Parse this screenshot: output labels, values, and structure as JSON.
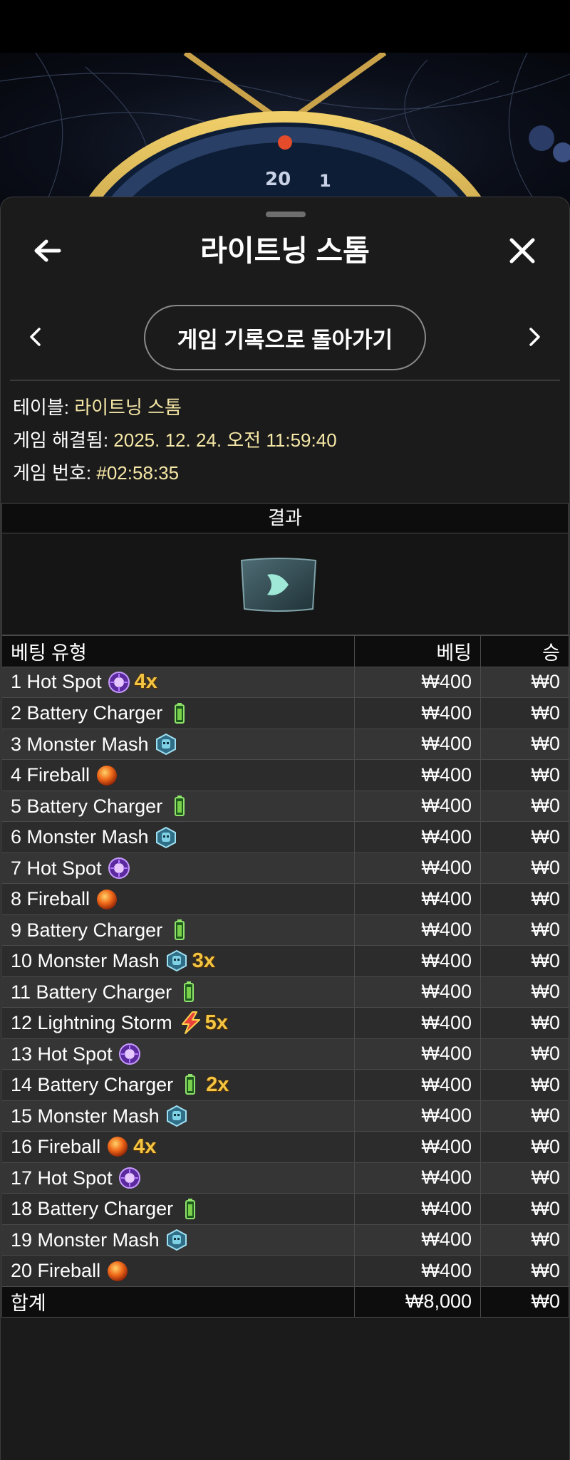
{
  "header": {
    "title": "라이트닝 스톰",
    "back_icon": "arrow-left-icon",
    "close_icon": "close-icon"
  },
  "navigation": {
    "prev_icon": "chevron-left-icon",
    "next_icon": "chevron-right-icon",
    "history_button": "게임 기록으로 돌아가기"
  },
  "info": {
    "table_label": "테이블:",
    "table_value": "라이트닝 스톰",
    "resolved_label": "게임 해결됨:",
    "resolved_value": "2025. 12. 24. 오전 11:59:40",
    "game_no_label": "게임 번호:",
    "game_no_value": "#02:58:35"
  },
  "result": {
    "heading": "결과",
    "icon": "result-card-icon"
  },
  "table": {
    "headers": [
      "베팅 유형",
      "베팅",
      "승"
    ],
    "rows": [
      {
        "label": "1 Hot Spot",
        "icon": "hot-spot",
        "mult": "4x",
        "bet": "₩400",
        "win": "₩0"
      },
      {
        "label": "2 Battery Charger",
        "icon": "battery",
        "mult": "",
        "bet": "₩400",
        "win": "₩0"
      },
      {
        "label": "3 Monster Mash",
        "icon": "monster",
        "mult": "",
        "bet": "₩400",
        "win": "₩0"
      },
      {
        "label": "4 Fireball",
        "icon": "fireball",
        "mult": "",
        "bet": "₩400",
        "win": "₩0"
      },
      {
        "label": "5 Battery Charger",
        "icon": "battery",
        "mult": "",
        "bet": "₩400",
        "win": "₩0"
      },
      {
        "label": "6 Monster Mash",
        "icon": "monster",
        "mult": "",
        "bet": "₩400",
        "win": "₩0"
      },
      {
        "label": "7 Hot Spot",
        "icon": "hot-spot",
        "mult": "",
        "bet": "₩400",
        "win": "₩0"
      },
      {
        "label": "8 Fireball",
        "icon": "fireball",
        "mult": "",
        "bet": "₩400",
        "win": "₩0"
      },
      {
        "label": "9 Battery Charger",
        "icon": "battery",
        "mult": "",
        "bet": "₩400",
        "win": "₩0"
      },
      {
        "label": "10 Monster Mash",
        "icon": "monster",
        "mult": "3x",
        "bet": "₩400",
        "win": "₩0"
      },
      {
        "label": "11 Battery Charger",
        "icon": "battery",
        "mult": "",
        "bet": "₩400",
        "win": "₩0"
      },
      {
        "label": "12 Lightning Storm",
        "icon": "lightning",
        "mult": "5x",
        "bet": "₩400",
        "win": "₩0"
      },
      {
        "label": "13 Hot Spot",
        "icon": "hot-spot",
        "mult": "",
        "bet": "₩400",
        "win": "₩0"
      },
      {
        "label": "14 Battery Charger",
        "icon": "battery",
        "mult": "2x",
        "bet": "₩400",
        "win": "₩0"
      },
      {
        "label": "15 Monster Mash",
        "icon": "monster",
        "mult": "",
        "bet": "₩400",
        "win": "₩0"
      },
      {
        "label": "16 Fireball",
        "icon": "fireball",
        "mult": "4x",
        "bet": "₩400",
        "win": "₩0"
      },
      {
        "label": "17 Hot Spot",
        "icon": "hot-spot",
        "mult": "",
        "bet": "₩400",
        "win": "₩0"
      },
      {
        "label": "18 Battery Charger",
        "icon": "battery",
        "mult": "",
        "bet": "₩400",
        "win": "₩0"
      },
      {
        "label": "19 Monster Mash",
        "icon": "monster",
        "mult": "",
        "bet": "₩400",
        "win": "₩0"
      },
      {
        "label": "20 Fireball",
        "icon": "fireball",
        "mult": "",
        "bet": "₩400",
        "win": "₩0"
      }
    ],
    "total": {
      "label": "합계",
      "bet": "₩8,000",
      "win": "₩0"
    }
  },
  "colors": {
    "accent_value": "#f5e7a6",
    "multiplier": "#f4c542",
    "sheet_bg": "#1b1b1b"
  }
}
